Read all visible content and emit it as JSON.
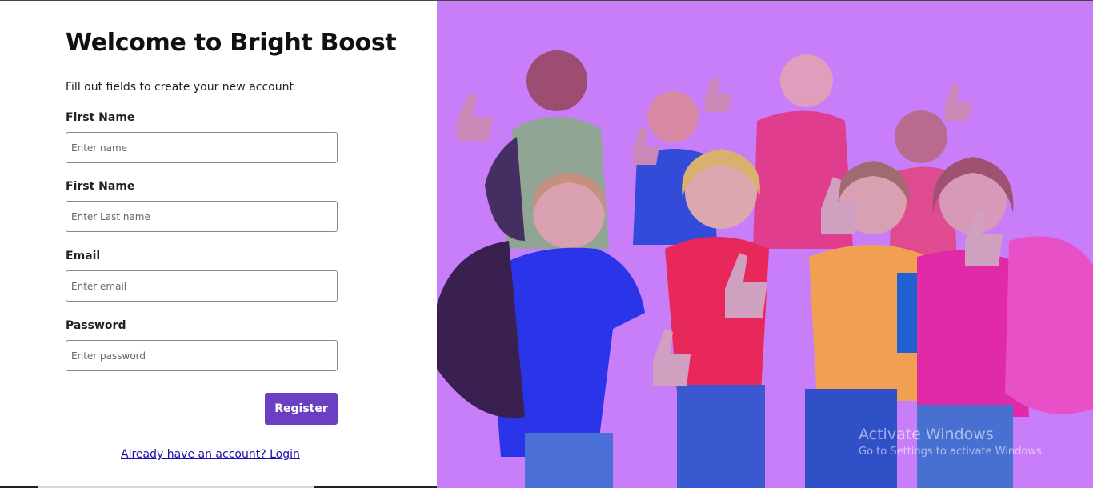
{
  "form": {
    "title": "Welcome to Bright Boost",
    "subtitle": "Fill out fields to create your new account",
    "fields": [
      {
        "label": "First Name",
        "placeholder": "Enter name",
        "value": ""
      },
      {
        "label": "First Name",
        "placeholder": "Enter Last name",
        "value": ""
      },
      {
        "label": "Email",
        "placeholder": "Enter email",
        "value": ""
      },
      {
        "label": "Password",
        "placeholder": "Enter password",
        "value": ""
      }
    ],
    "register_label": "Register",
    "login_link": "Already have an account? Login"
  },
  "hero": {
    "overlay_color": "#c87ef8",
    "image_subject": "group-of-children-thumbs-up-photo"
  },
  "watermark": {
    "line1": "Activate Windows",
    "line2": "Go to Settings to activate Windows."
  },
  "colors": {
    "accent": "#6a3fc1",
    "link": "#1a0dab"
  }
}
